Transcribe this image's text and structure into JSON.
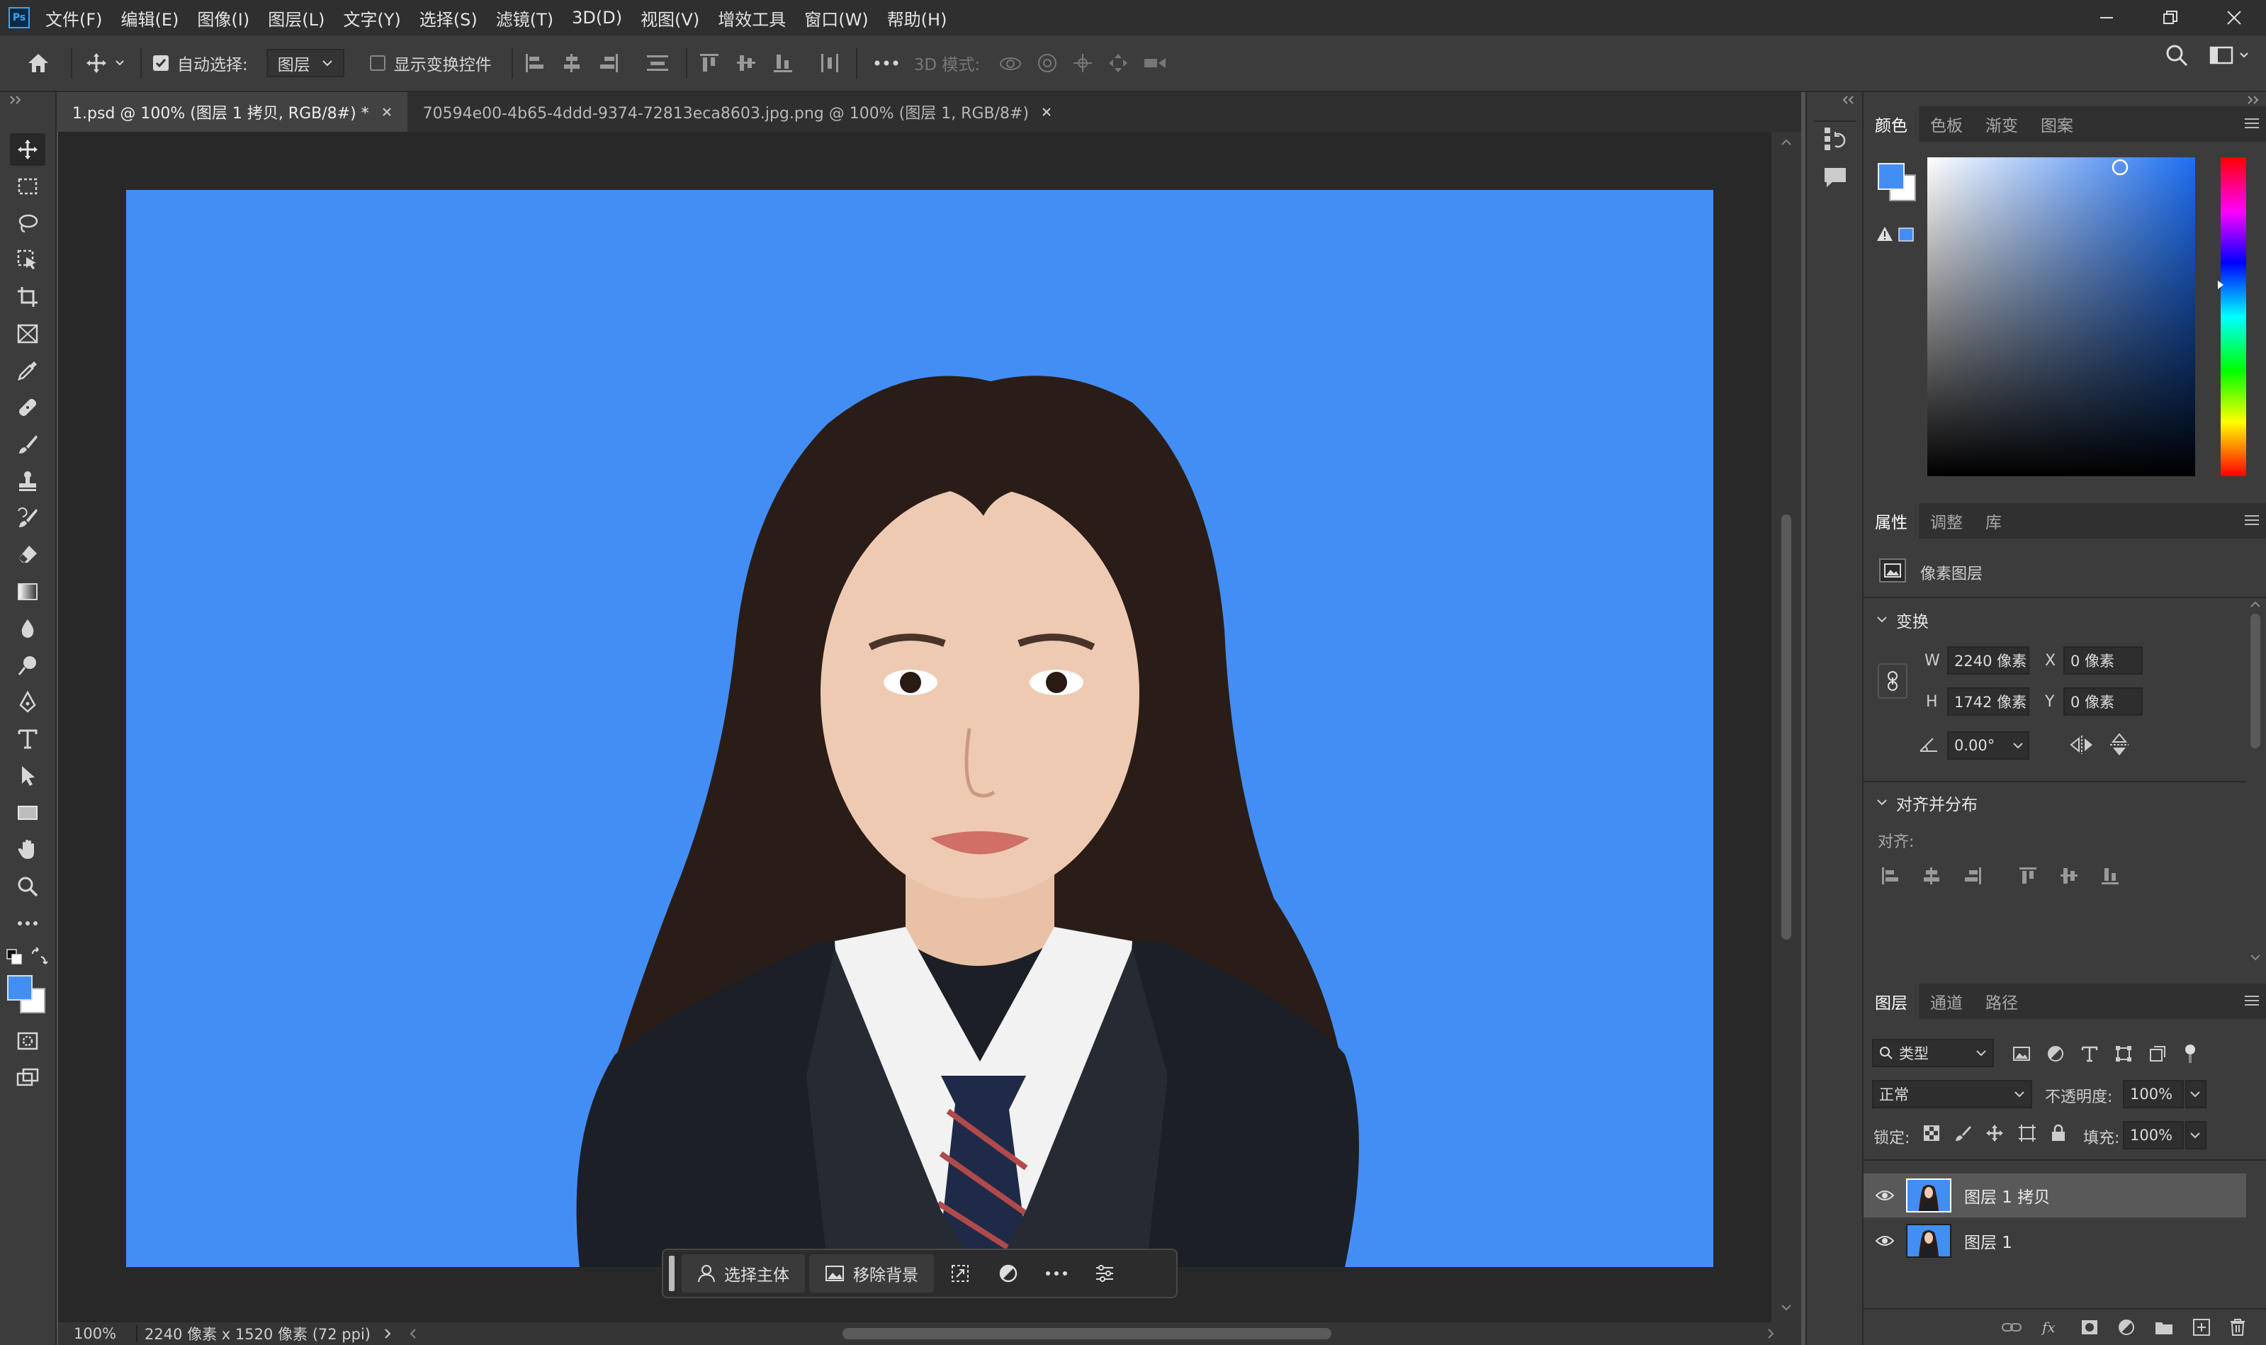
{
  "app": {
    "logo": "Ps",
    "menu": [
      "文件(F)",
      "编辑(E)",
      "图像(I)",
      "图层(L)",
      "文字(Y)",
      "选择(S)",
      "滤镜(T)",
      "3D(D)",
      "视图(V)",
      "增效工具",
      "窗口(W)",
      "帮助(H)"
    ]
  },
  "options": {
    "auto_select_label": "自动选择:",
    "auto_select_value": "图层",
    "show_transform_label": "显示变换控件",
    "mode_3d_label": "3D 模式:"
  },
  "tabs": [
    {
      "label": "1.psd @ 100% (图层 1 拷贝, RGB/8#) *"
    },
    {
      "label": "70594e00-4b65-4ddd-9374-72813eca8603.jpg.png @ 100% (图层 1, RGB/8#)"
    }
  ],
  "status": {
    "zoom": "100%",
    "doc_size": "2240 像素 x 1520 像素 (72 ppi)"
  },
  "taskbar": {
    "select_subject": "选择主体",
    "remove_background": "移除背景"
  },
  "color_panel": {
    "tabs": [
      "颜色",
      "色板",
      "渐变",
      "图案"
    ],
    "foreground": "#438ef5",
    "background": "#ffffff"
  },
  "properties": {
    "tabs": [
      "属性",
      "调整",
      "库"
    ],
    "layer_type": "像素图层",
    "transform_title": "变换",
    "w_label": "W",
    "w_value": "2240 像素",
    "h_label": "H",
    "h_value": "1742 像素",
    "x_label": "X",
    "x_value": "0 像素",
    "y_label": "Y",
    "y_value": "0 像素",
    "angle_value": "0.00°",
    "align_title": "对齐并分布",
    "align_label": "对齐:"
  },
  "layers_panel": {
    "tabs": [
      "图层",
      "通道",
      "路径"
    ],
    "filter_label": "类型",
    "blend_mode": "正常",
    "opacity_label": "不透明度:",
    "opacity_value": "100%",
    "lock_label": "锁定:",
    "fill_label": "填充:",
    "fill_value": "100%",
    "layers": [
      {
        "name": "图层 1 拷贝",
        "selected": true
      },
      {
        "name": "图层 1",
        "selected": false
      }
    ]
  }
}
